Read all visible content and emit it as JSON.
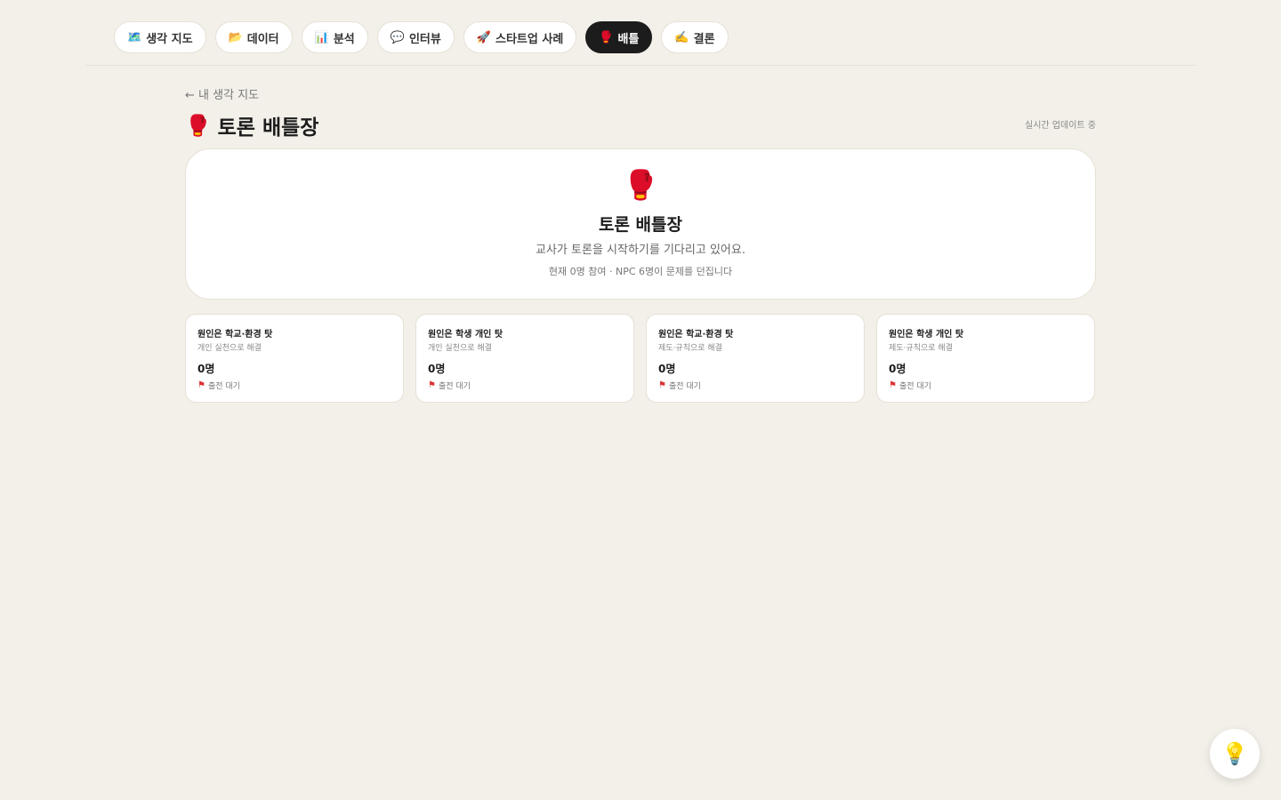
{
  "nav": {
    "tabs": [
      {
        "icon": "🗺️",
        "label": "생각 지도",
        "active": false
      },
      {
        "icon": "📂",
        "label": "데이터",
        "active": false
      },
      {
        "icon": "📊",
        "label": "분석",
        "active": false
      },
      {
        "icon": "💬",
        "label": "인터뷰",
        "active": false
      },
      {
        "icon": "🚀",
        "label": "스타트업 사례",
        "active": false
      },
      {
        "icon": "🥊",
        "label": "배틀",
        "active": true
      },
      {
        "icon": "✍️",
        "label": "결론",
        "active": false
      }
    ]
  },
  "back": {
    "label": "← 내 생각 지도"
  },
  "header": {
    "icon": "🥊",
    "title": "토론 배틀장",
    "status": "실시간 업데이트 중"
  },
  "hero": {
    "icon": "🥊",
    "title": "토론 배틀장",
    "subtitle": "교사가 토론을 시작하기를 기다리고 있어요.",
    "meta": "현재 0명 참여 · NPC 6명이 문제를 던집니다"
  },
  "teams": [
    {
      "name": "원인은 학교·환경 탓",
      "desc": "개인 실천으로 해결",
      "count": "0명",
      "status": "출전 대기"
    },
    {
      "name": "원인은 학생 개인 탓",
      "desc": "개인 실천으로 해결",
      "count": "0명",
      "status": "출전 대기"
    },
    {
      "name": "원인은 학교·환경 탓",
      "desc": "제도·규칙으로 해결",
      "count": "0명",
      "status": "출전 대기"
    },
    {
      "name": "원인은 학생 개인 탓",
      "desc": "제도·규칙으로 해결",
      "count": "0명",
      "status": "출전 대기"
    }
  ],
  "fab": {
    "icon": "💡",
    "icon_name": "lightbulb-icon"
  }
}
